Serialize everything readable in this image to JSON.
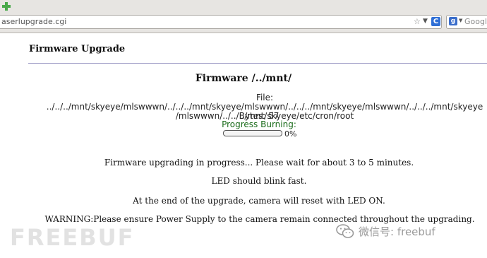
{
  "browser": {
    "address": "aserlupgrade.cgi",
    "search_placeholder": "Google",
    "search_engine_letter": "g",
    "reload_glyph": "C"
  },
  "page": {
    "title": "Firmware Upgrade",
    "firmware_heading": "Firmware /../mnt/",
    "file_line": "File: ../../../mnt/skyeye/mlswwwn/../../../mnt/skyeye/mlswwwn/../../../mnt/skyeye/mlswwwn/../../../mnt/skyeye /mlswwwn/../../../mnt/skyeye/etc/cron/root",
    "bytes_line": "Bytes: 57",
    "burning_label": "Progress Burning:",
    "progress_text": "0%",
    "progress_value": 0,
    "message_wait": "Firmware upgrading in progress... Please wait for about 3 to 5 minutes.",
    "message_led": "LED should blink fast.",
    "message_reset": "At the end of the upgrade, camera will reset with LED ON.",
    "message_warning": "WARNING:Please ensure Power Supply to the camera remain connected throughout the upgrading."
  },
  "watermark": {
    "left_text": "FREEBUF",
    "right_text": "微信号: freebuf"
  },
  "colors": {
    "accent_green": "#1a6b1a",
    "rule": "#9a98c4"
  },
  "icons": [
    "add-tab-icon",
    "bookmark-star-icon",
    "dropdown-arrow-icon",
    "reload-icon",
    "search-engine-icon",
    "wechat-icon"
  ]
}
